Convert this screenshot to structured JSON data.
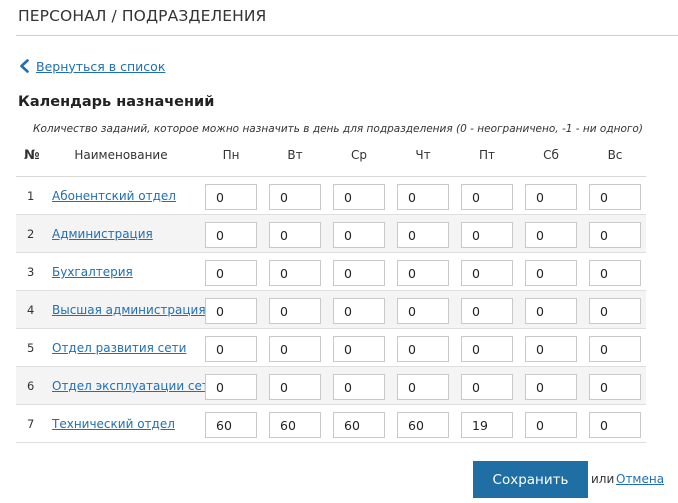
{
  "header": {
    "title": "ПЕРСОНАЛ / ПОДРАЗДЕЛЕНИЯ"
  },
  "nav": {
    "back_label": "Вернуться в список"
  },
  "calendar": {
    "title": "Календарь назначений",
    "note": "Количество заданий, которое можно назначить в день для подразделения (0 - неограничено, -1 - ни одного)",
    "columns": {
      "num": "№",
      "name": "Наименование",
      "days": [
        "Пн",
        "Вт",
        "Ср",
        "Чт",
        "Пт",
        "Сб",
        "Вс"
      ]
    },
    "rows": [
      {
        "num": "1",
        "name": "Абонентский отдел",
        "values": [
          "0",
          "0",
          "0",
          "0",
          "0",
          "0",
          "0"
        ]
      },
      {
        "num": "2",
        "name": "Администрация",
        "values": [
          "0",
          "0",
          "0",
          "0",
          "0",
          "0",
          "0"
        ]
      },
      {
        "num": "3",
        "name": "Бухгалтерия",
        "values": [
          "0",
          "0",
          "0",
          "0",
          "0",
          "0",
          "0"
        ]
      },
      {
        "num": "4",
        "name": "Высшая администрация",
        "values": [
          "0",
          "0",
          "0",
          "0",
          "0",
          "0",
          "0"
        ]
      },
      {
        "num": "5",
        "name": "Отдел развития сети",
        "values": [
          "0",
          "0",
          "0",
          "0",
          "0",
          "0",
          "0"
        ]
      },
      {
        "num": "6",
        "name": "Отдел эксплуатации сети",
        "values": [
          "0",
          "0",
          "0",
          "0",
          "0",
          "0",
          "0"
        ]
      },
      {
        "num": "7",
        "name": "Технический отдел",
        "values": [
          "60",
          "60",
          "60",
          "60",
          "19",
          "0",
          "0"
        ]
      }
    ]
  },
  "actions": {
    "save_label": "Сохранить",
    "or_label": "или",
    "cancel_label": "Отмена"
  },
  "colors": {
    "link": "#1f6fb2",
    "primary_button": "#1f6fa5"
  }
}
